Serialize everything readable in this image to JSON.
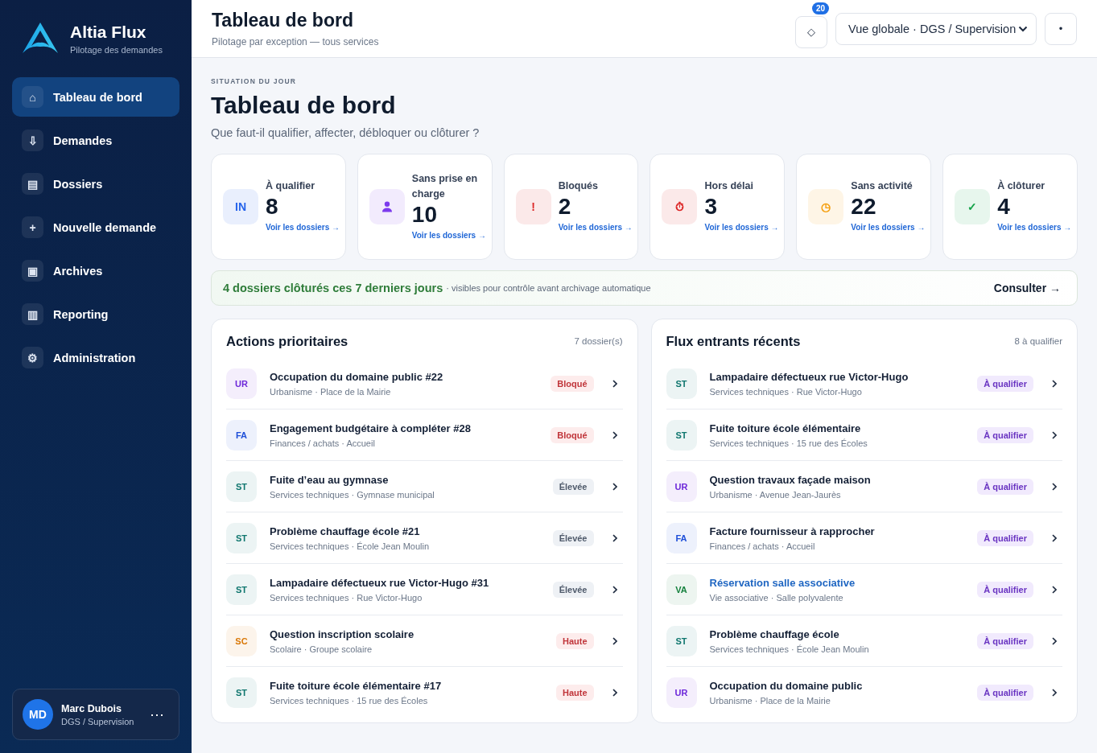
{
  "brand": {
    "name": "Altia Flux",
    "tagline": "Pilotage des demandes"
  },
  "sidebar": {
    "items": [
      {
        "icon": "⌂",
        "label": "Tableau de bord",
        "selected": true
      },
      {
        "icon": "⇩",
        "label": "Demandes",
        "selected": false
      },
      {
        "icon": "▤",
        "label": "Dossiers",
        "selected": false
      },
      {
        "icon": "+",
        "label": "Nouvelle demande",
        "selected": false
      },
      {
        "icon": "▣",
        "label": "Archives",
        "selected": false
      },
      {
        "icon": "▥",
        "label": "Reporting",
        "selected": false
      },
      {
        "icon": "⚙",
        "label": "Administration",
        "selected": false
      }
    ],
    "user": {
      "initials": "MD",
      "name": "Marc Dubois",
      "role": "DGS / Supervision",
      "menu": "⋯"
    }
  },
  "header": {
    "title": "Tableau de bord",
    "subtitle": "Pilotage par exception — tous services",
    "notif_icon": "◇",
    "notif_count": "20",
    "view_select": "Vue globale · DGS / Supervision",
    "more": "•"
  },
  "page": {
    "eyebrow": "SITUATION DU JOUR",
    "title": "Tableau de bord",
    "question": "Que faut-il qualifier, affecter, débloquer ou clôturer ?"
  },
  "kpis": [
    {
      "kind": "glyph",
      "icon": "IN",
      "label": "À qualifier",
      "value": "8",
      "link": "Voir les dossiers →",
      "color": "#2563eb"
    },
    {
      "kind": "person",
      "label": "Sans prise en charge",
      "value": "10",
      "link": "Voir les dossiers →",
      "color": "#7c3aed"
    },
    {
      "kind": "glyph",
      "icon": "!",
      "label": "Bloqués",
      "value": "2",
      "link": "Voir les dossiers →",
      "color": "#dc2626"
    },
    {
      "kind": "glyph",
      "icon": "⏱",
      "label": "Hors délai",
      "value": "3",
      "link": "Voir les dossiers →",
      "color": "#dc2626"
    },
    {
      "kind": "glyph",
      "icon": "◷",
      "label": "Sans activité",
      "value": "22",
      "link": "Voir les dossiers →",
      "color": "#f59e0b"
    },
    {
      "kind": "glyph",
      "icon": "✓",
      "label": "À clôturer",
      "value": "4",
      "link": "Voir les dossiers →",
      "color": "#16a34a"
    }
  ],
  "closed_banner": {
    "headline": "4 dossiers clôturés ces 7 derniers jours",
    "note": "· visibles pour contrôle avant archivage automatique",
    "action": "Consulter →"
  },
  "panels": [
    {
      "title": "Actions prioritaires",
      "count": "7 dossier(s)",
      "rows": [
        {
          "initials": "UR",
          "color": "#6d28d9",
          "title": "Occupation du domaine public #22",
          "meta": "Urbanisme · Place de la Mairie",
          "badge": "Bloqué",
          "kind": "danger",
          "hovered": false
        },
        {
          "initials": "FA",
          "color": "#1d4ed8",
          "title": "Engagement budgétaire à compléter #28",
          "meta": "Finances / achats · Accueil",
          "badge": "Bloqué",
          "kind": "danger",
          "hovered": false
        },
        {
          "initials": "ST",
          "color": "#0f766e",
          "title": "Fuite d’eau au gymnase",
          "meta": "Services techniques · Gymnase municipal",
          "badge": "Élevée",
          "kind": "neutral",
          "hovered": false
        },
        {
          "initials": "ST",
          "color": "#0f766e",
          "title": "Problème chauffage école #21",
          "meta": "Services techniques · École Jean Moulin",
          "badge": "Élevée",
          "kind": "neutral",
          "hovered": false
        },
        {
          "initials": "ST",
          "color": "#0f766e",
          "title": "Lampadaire défectueux rue Victor-Hugo #31",
          "meta": "Services techniques · Rue Victor-Hugo",
          "badge": "Élevée",
          "kind": "neutral",
          "hovered": false
        },
        {
          "initials": "SC",
          "color": "#d97706",
          "title": "Question inscription scolaire",
          "meta": "Scolaire · Groupe scolaire",
          "badge": "Haute",
          "kind": "danger",
          "hovered": false
        },
        {
          "initials": "ST",
          "color": "#0f766e",
          "title": "Fuite toiture école élémentaire #17",
          "meta": "Services techniques · 15 rue des Écoles",
          "badge": "Haute",
          "kind": "danger",
          "hovered": false
        }
      ]
    },
    {
      "title": "Flux entrants récents",
      "count": "8 à qualifier",
      "rows": [
        {
          "initials": "ST",
          "color": "#0f766e",
          "title": "Lampadaire défectueux rue Victor-Hugo",
          "meta": "Services techniques · Rue Victor-Hugo",
          "badge": "À qualifier",
          "kind": "qualify",
          "hovered": false
        },
        {
          "initials": "ST",
          "color": "#0f766e",
          "title": "Fuite toiture école élémentaire",
          "meta": "Services techniques · 15 rue des Écoles",
          "badge": "À qualifier",
          "kind": "qualify",
          "hovered": false
        },
        {
          "initials": "UR",
          "color": "#6d28d9",
          "title": "Question travaux façade maison",
          "meta": "Urbanisme · Avenue Jean-Jaurès",
          "badge": "À qualifier",
          "kind": "qualify",
          "hovered": false
        },
        {
          "initials": "FA",
          "color": "#1d4ed8",
          "title": "Facture fournisseur à rapprocher",
          "meta": "Finances / achats · Accueil",
          "badge": "À qualifier",
          "kind": "qualify",
          "hovered": false
        },
        {
          "initials": "VA",
          "color": "#15803d",
          "title": "Réservation salle associative",
          "meta": "Vie associative · Salle polyvalente",
          "badge": "À qualifier",
          "kind": "qualify",
          "hovered": true
        },
        {
          "initials": "ST",
          "color": "#0f766e",
          "title": "Problème chauffage école",
          "meta": "Services techniques · École Jean Moulin",
          "badge": "À qualifier",
          "kind": "qualify",
          "hovered": false
        },
        {
          "initials": "UR",
          "color": "#6d28d9",
          "title": "Occupation du domaine public",
          "meta": "Urbanisme · Place de la Mairie",
          "badge": "À qualifier",
          "kind": "qualify",
          "hovered": false
        }
      ]
    }
  ]
}
